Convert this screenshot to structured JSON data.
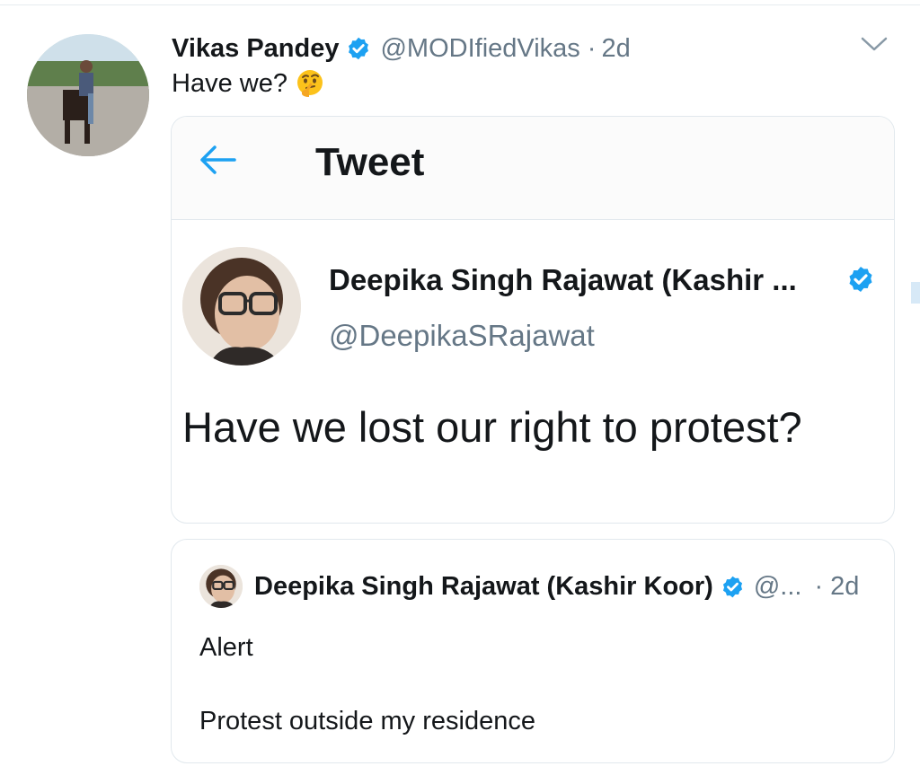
{
  "tweet": {
    "author_name": "Vikas Pandey",
    "author_handle": "@MODIfiedVikas",
    "separator": "·",
    "time": "2d",
    "text": "Have we?",
    "emoji": "thinking-face-emoji"
  },
  "screenshot_card": {
    "header_title": "Tweet",
    "author_name": "Deepika Singh Rajawat (Kashir ...",
    "author_handle": "@DeepikaSRajawat",
    "text": "Have we lost our right to protest?"
  },
  "quoted_tweet": {
    "author_name": "Deepika Singh Rajawat (Kashir Koor)",
    "author_handle": "@...",
    "time": "· 2d",
    "line1": "Alert",
    "line2": "Protest outside my residence"
  },
  "colors": {
    "verified_blue": "#1da1f2",
    "text": "#14171a",
    "secondary": "#657786",
    "border": "#e1e8ed"
  }
}
